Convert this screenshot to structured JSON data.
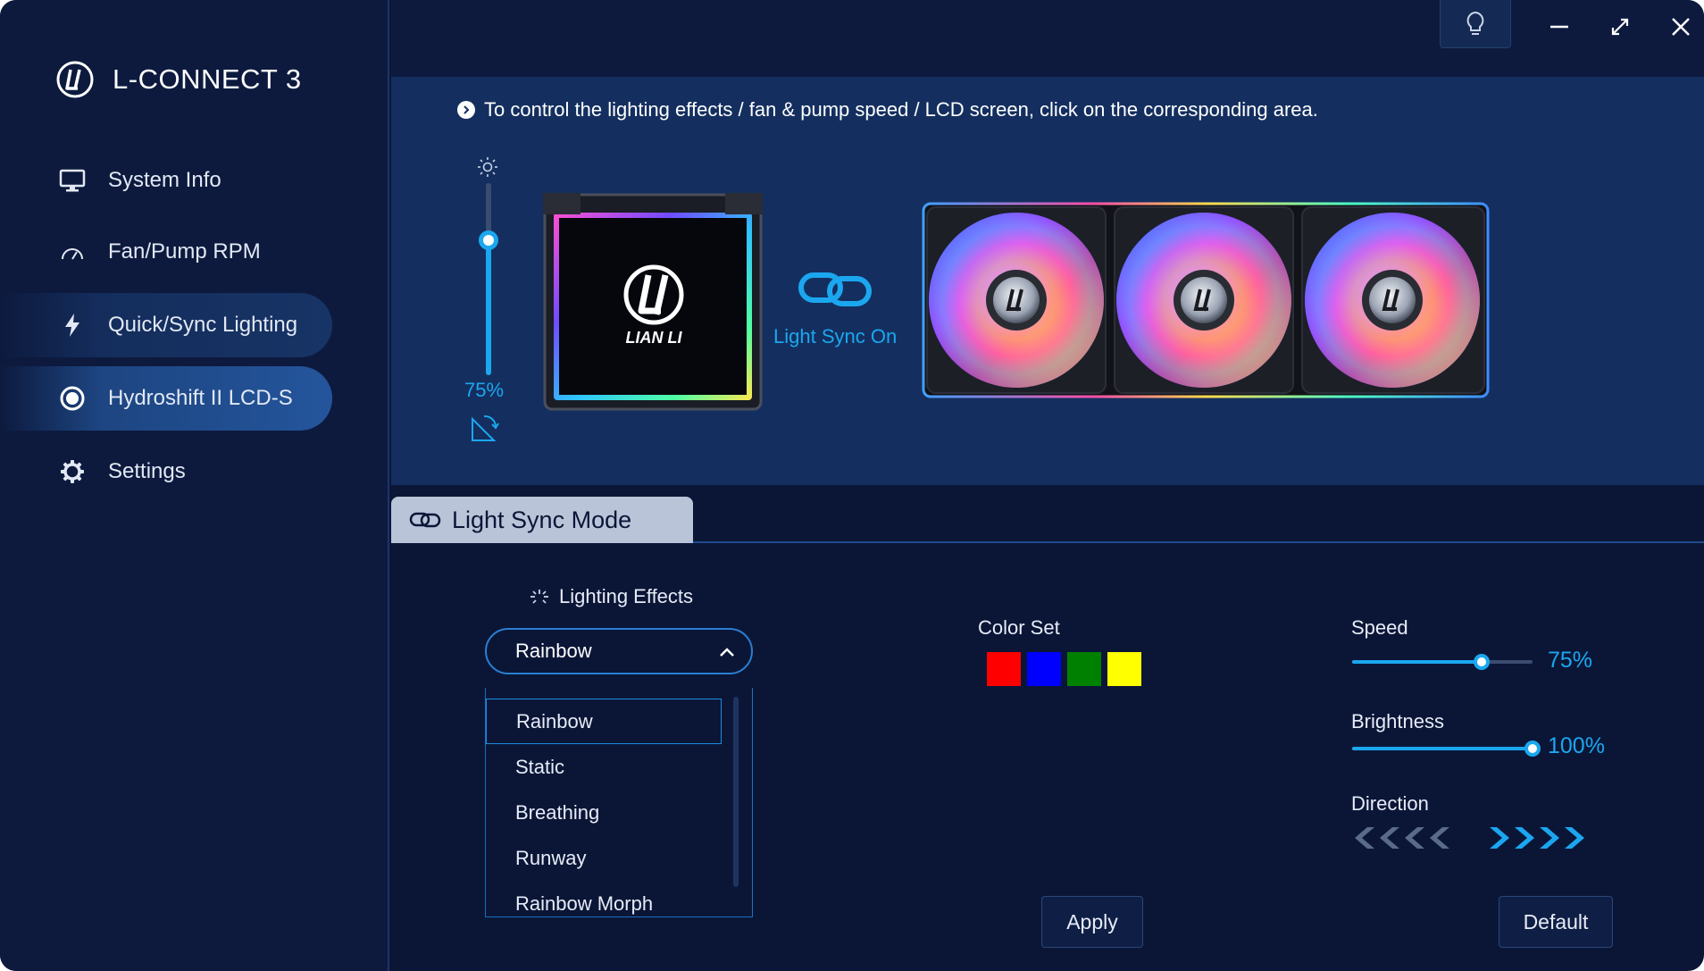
{
  "app": {
    "title": "L-CONNECT 3"
  },
  "sidebar": {
    "items": [
      {
        "label": "System Info",
        "icon": "monitor-icon"
      },
      {
        "label": "Fan/Pump RPM",
        "icon": "gauge-icon"
      },
      {
        "label": "Quick/Sync Lighting",
        "icon": "lightning-icon"
      },
      {
        "label": "Hydroshift II LCD-S",
        "icon": "radio-dot-icon",
        "active": true
      },
      {
        "label": "Settings",
        "icon": "gear-icon"
      }
    ]
  },
  "window_controls": [
    "lightbulb-icon",
    "minimize-icon",
    "maximize-icon",
    "close-icon"
  ],
  "device_panel": {
    "hint": "To control the lighting effects / fan & pump speed / LCD screen, click on the corresponding area.",
    "lcd_brightness": "75%",
    "lcd_brightness_value": 0.75,
    "pump_logo_text": "LIAN LI",
    "sync_label": "Light Sync On"
  },
  "tabs": {
    "active": "Light Sync Mode"
  },
  "effects": {
    "title": "Lighting Effects",
    "selected": "Rainbow",
    "options": [
      "Rainbow",
      "Static",
      "Breathing",
      "Runway",
      "Rainbow Morph"
    ]
  },
  "color_set": {
    "title": "Color Set",
    "colors": [
      "#ff0000",
      "#0000ff",
      "#008000",
      "#ffff00"
    ]
  },
  "params": {
    "speed": {
      "label": "Speed",
      "value": "75%",
      "level": 0.72
    },
    "brightness": {
      "label": "Brightness",
      "value": "100%",
      "level": 1.0
    },
    "direction": {
      "label": "Direction",
      "selected": "right"
    }
  },
  "buttons": {
    "apply": "Apply",
    "default": "Default"
  },
  "colors": {
    "accent": "#1ba7ef",
    "sidebar_bg": "#0d1a3e",
    "panel_bg": "#142f5f",
    "window_bg": "#0b1637"
  }
}
